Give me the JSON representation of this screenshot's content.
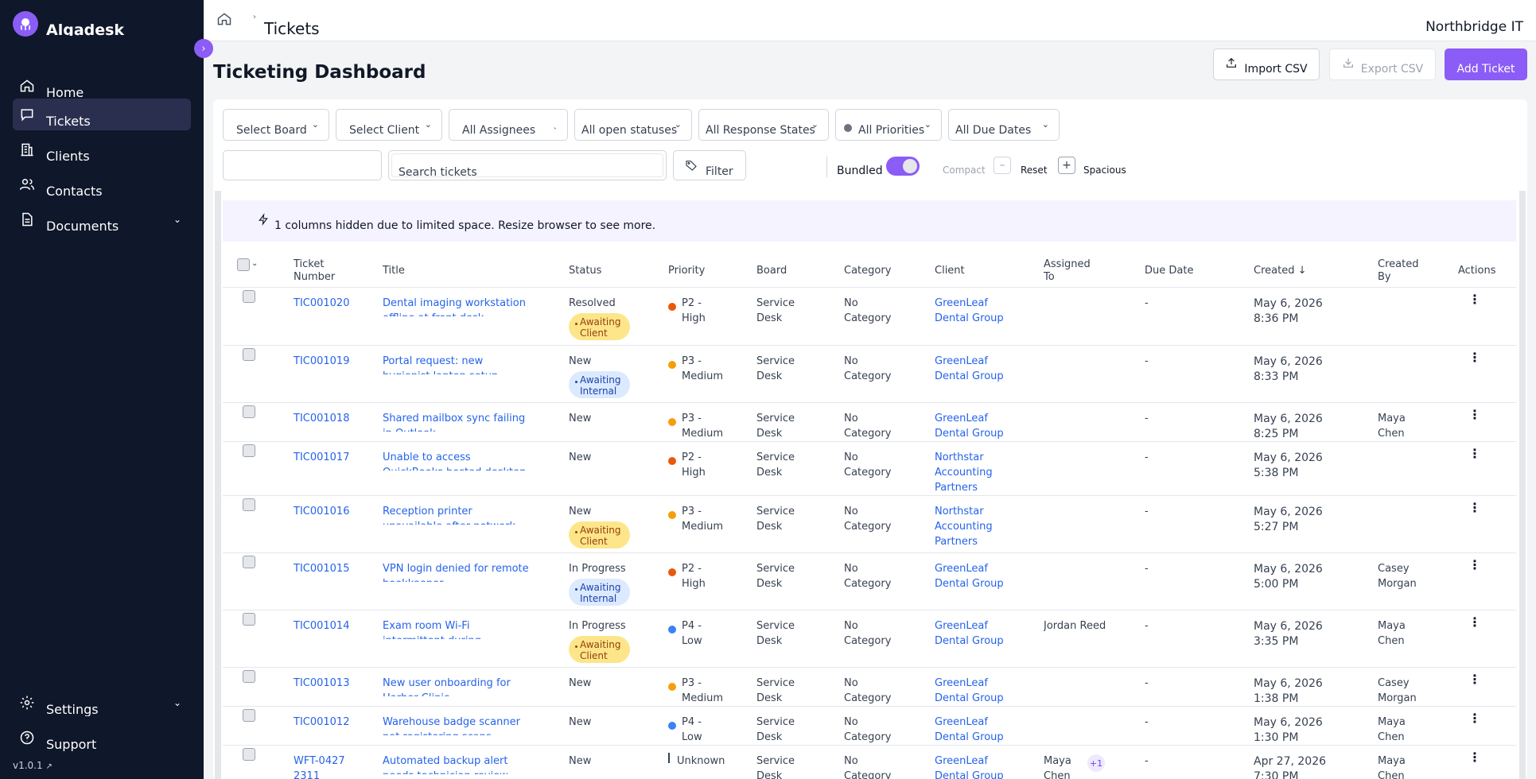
{
  "sidebar": {
    "brand": "Algadesk",
    "items": [
      {
        "label": "Home"
      },
      {
        "label": "Tickets"
      },
      {
        "label": "Clients"
      },
      {
        "label": "Contacts"
      },
      {
        "label": "Documents"
      }
    ],
    "settings": "Settings",
    "support": "Support",
    "version": "v1.0.1"
  },
  "header": {
    "breadcrumb_sep": "›",
    "title": "Tickets",
    "org": "Northbridge IT"
  },
  "page": {
    "title": "Ticketing Dashboard",
    "import_label": "Import CSV",
    "export_label": "Export CSV",
    "add_label": "Add Ticket"
  },
  "filters": {
    "board": "Select Board",
    "client": "Select Client",
    "assignees": "All Assignees",
    "statuses": "All open statuses",
    "response_states": "All Response States",
    "priorities": "All Priorities",
    "due_dates": "All Due Dates",
    "search_placeholder": "Search tickets",
    "filter_label": "Filter",
    "bundled_label": "Bundled",
    "bundled_on": true,
    "compact_label": "Compact",
    "reset_label": "Reset",
    "spacious_label": "Spacious"
  },
  "notice": "1 columns hidden due to limited space. Resize browser to see more.",
  "columns": {
    "ticket_number": "Ticket Number",
    "title": "Title",
    "status": "Status",
    "priority": "Priority",
    "board": "Board",
    "category": "Category",
    "client": "Client",
    "assigned_to": "Assigned To",
    "due_date": "Due Date",
    "created": "Created ↓",
    "created_by": "Created By",
    "actions": "Actions"
  },
  "colors": {
    "accent": "#8b5cf6",
    "high": "#ea580c",
    "medium": "#f59e0b",
    "low": "#3b82f6"
  },
  "rows": [
    {
      "num": "TIC001020",
      "title": "Dental imaging workstation offline at front desk",
      "status": "Resolved",
      "badge": "Awaiting Client",
      "badge_type": "client",
      "priority": "P2 - High",
      "pcolor": "#ea580c",
      "board": "Service Desk",
      "category": "No Category",
      "client": "GreenLeaf Dental Group",
      "assigned": "",
      "due": "-",
      "created": "May 6, 2026 8:36 PM",
      "created_by": ""
    },
    {
      "num": "TIC001019",
      "title": "Portal request: new hygienist laptop setup",
      "status": "New",
      "badge": "Awaiting Internal",
      "badge_type": "internal",
      "priority": "P3 - Medium",
      "pcolor": "#f59e0b",
      "board": "Service Desk",
      "category": "No Category",
      "client": "GreenLeaf Dental Group",
      "assigned": "",
      "due": "-",
      "created": "May 6, 2026 8:33 PM",
      "created_by": ""
    },
    {
      "num": "TIC001018",
      "title": "Shared mailbox sync failing in Outlook",
      "status": "New",
      "badge": "",
      "badge_type": "",
      "priority": "P3 - Medium",
      "pcolor": "#f59e0b",
      "board": "Service Desk",
      "category": "No Category",
      "client": "GreenLeaf Dental Group",
      "assigned": "",
      "due": "-",
      "created": "May 6, 2026 8:25 PM",
      "created_by": "Maya Chen"
    },
    {
      "num": "TIC001017",
      "title": "Unable to access QuickBooks hosted desktop",
      "status": "New",
      "badge": "",
      "badge_type": "",
      "priority": "P2 - High",
      "pcolor": "#ea580c",
      "board": "Service Desk",
      "category": "No Category",
      "client": "Northstar Accounting Partners",
      "assigned": "",
      "due": "-",
      "created": "May 6, 2026 5:38 PM",
      "created_by": ""
    },
    {
      "num": "TIC001016",
      "title": "Reception printer unavailable after network change",
      "status": "New",
      "badge": "Awaiting Client",
      "badge_type": "client",
      "priority": "P3 - Medium",
      "pcolor": "#f59e0b",
      "board": "Service Desk",
      "category": "No Category",
      "client": "Northstar Accounting Partners",
      "assigned": "",
      "due": "-",
      "created": "May 6, 2026 5:27 PM",
      "created_by": ""
    },
    {
      "num": "TIC001015",
      "title": "VPN login denied for remote bookkeeper",
      "status": "In Progress",
      "badge": "Awaiting Internal",
      "badge_type": "internal",
      "priority": "P2 - High",
      "pcolor": "#ea580c",
      "board": "Service Desk",
      "category": "No Category",
      "client": "GreenLeaf Dental Group",
      "assigned": "",
      "due": "-",
      "created": "May 6, 2026 5:00 PM",
      "created_by": "Casey Morgan"
    },
    {
      "num": "TIC001014",
      "title": "Exam room Wi-Fi intermittent during appointments",
      "status": "In Progress",
      "badge": "Awaiting Client",
      "badge_type": "client",
      "priority": "P4 - Low",
      "pcolor": "#3b82f6",
      "board": "Service Desk",
      "category": "No Category",
      "client": "GreenLeaf Dental Group",
      "assigned": "Jordan Reed",
      "due": "-",
      "created": "May 6, 2026 3:35 PM",
      "created_by": "Maya Chen"
    },
    {
      "num": "TIC001013",
      "title": "New user onboarding for Harbor Clinic",
      "status": "New",
      "badge": "",
      "badge_type": "",
      "priority": "P3 - Medium",
      "pcolor": "#f59e0b",
      "board": "Service Desk",
      "category": "No Category",
      "client": "GreenLeaf Dental Group",
      "assigned": "",
      "due": "-",
      "created": "May 6, 2026 1:38 PM",
      "created_by": "Casey Morgan"
    },
    {
      "num": "TIC001012",
      "title": "Warehouse badge scanner not registering scans",
      "status": "New",
      "badge": "",
      "badge_type": "",
      "priority": "P4 - Low",
      "pcolor": "#3b82f6",
      "board": "Service Desk",
      "category": "No Category",
      "client": "GreenLeaf Dental Group",
      "assigned": "",
      "due": "-",
      "created": "May 6, 2026 1:30 PM",
      "created_by": "Maya Chen"
    },
    {
      "num": "WFT-0427 2311",
      "title": "Automated backup alert needs technician review",
      "status": "New",
      "badge": "",
      "badge_type": "",
      "priority": "Unknown",
      "pcolor": "",
      "board": "Service Desk",
      "category": "No Category",
      "client": "GreenLeaf Dental Group",
      "assigned": "Maya Chen",
      "assigned_extra": "+1",
      "due": "-",
      "created": "Apr 27, 2026 7:30 PM",
      "created_by": "Maya Chen"
    }
  ]
}
